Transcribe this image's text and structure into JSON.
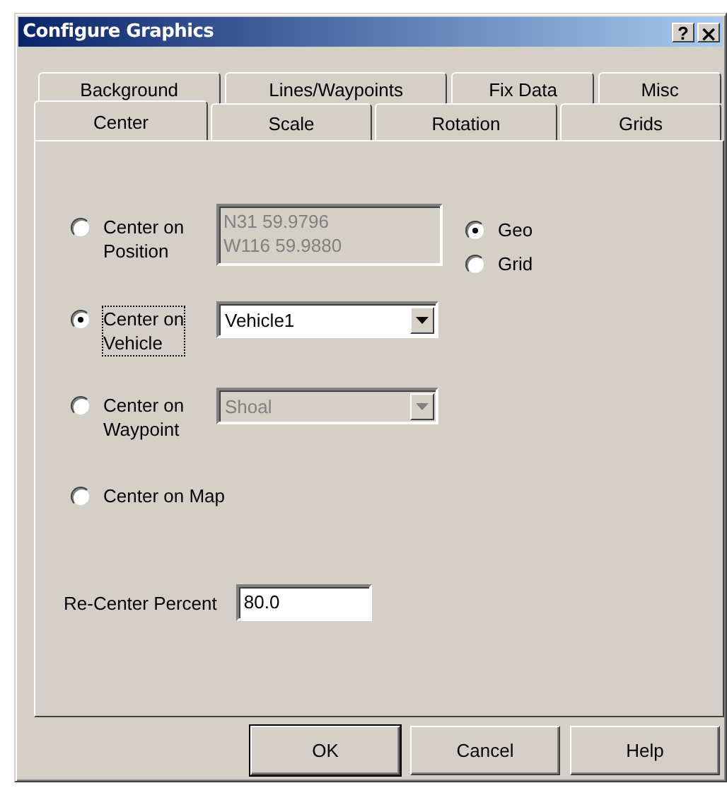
{
  "window": {
    "title": "Configure Graphics",
    "controls": [
      {
        "kind": "help",
        "label": "?"
      },
      {
        "kind": "close",
        "label": "×"
      }
    ]
  },
  "tab_rows": [
    {
      "tabs": [
        {
          "label": "Background",
          "selected": false
        },
        {
          "label": "Lines/Waypoints",
          "selected": false
        },
        {
          "label": "Fix Data",
          "selected": false
        },
        {
          "label": "Misc",
          "selected": false
        }
      ]
    },
    {
      "tabs": [
        {
          "label": "Center",
          "selected": true
        },
        {
          "label": "Scale",
          "selected": false
        },
        {
          "label": "Rotation",
          "selected": false
        },
        {
          "label": "Grids",
          "selected": false
        }
      ]
    }
  ],
  "center_options": [
    {
      "kind": "position",
      "label_lines": [
        "Center on",
        "Position"
      ],
      "selected": false,
      "focused": false,
      "field": {
        "value_lines": [
          "N31 59.9796",
          "W116 59.9880"
        ],
        "disabled": true
      },
      "coordinate_systems": [
        {
          "label": "Geo",
          "selected": true
        },
        {
          "label": "Grid",
          "selected": false
        }
      ]
    },
    {
      "kind": "vehicle",
      "label_lines": [
        "Center on",
        "Vehicle"
      ],
      "selected": true,
      "focused": true,
      "combo": {
        "value": "Vehicle1",
        "disabled": false
      }
    },
    {
      "kind": "waypoint",
      "label_lines": [
        "Center on",
        "Waypoint"
      ],
      "selected": false,
      "focused": false,
      "combo": {
        "value": "Shoal",
        "disabled": true
      }
    },
    {
      "kind": "map",
      "label_lines": [
        "Center on Map"
      ],
      "selected": false,
      "focused": false
    }
  ],
  "recenter": {
    "label": "Re-Center Percent",
    "value": "80.0"
  },
  "buttons": [
    {
      "label": "OK",
      "default": true
    },
    {
      "label": "Cancel",
      "default": false
    },
    {
      "label": "Help",
      "default": false
    }
  ]
}
